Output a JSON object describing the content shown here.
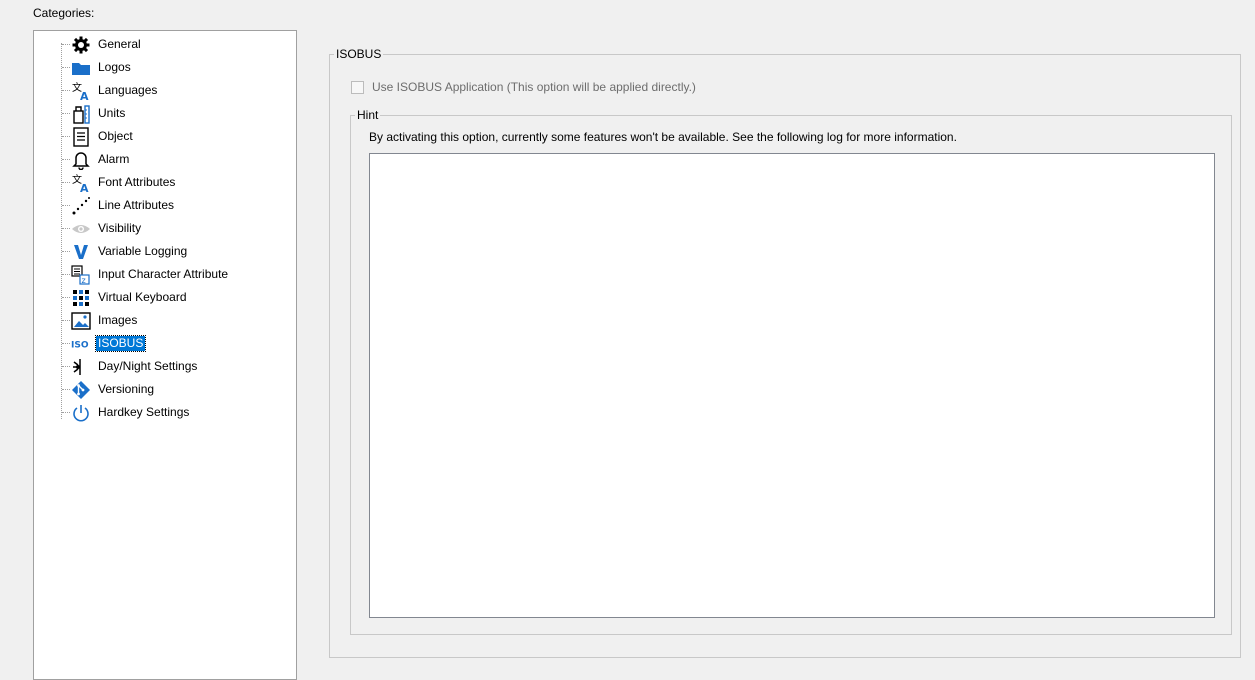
{
  "categories_label": "Categories:",
  "tree": {
    "items": [
      {
        "label": "General",
        "icon": "gear-icon"
      },
      {
        "label": "Logos",
        "icon": "folder-icon"
      },
      {
        "label": "Languages",
        "icon": "translate-icon"
      },
      {
        "label": "Units",
        "icon": "units-icon"
      },
      {
        "label": "Object",
        "icon": "document-icon"
      },
      {
        "label": "Alarm",
        "icon": "bell-icon"
      },
      {
        "label": "Font Attributes",
        "icon": "translate-icon"
      },
      {
        "label": "Line Attributes",
        "icon": "dotted-line-icon"
      },
      {
        "label": "Visibility",
        "icon": "eye-icon"
      },
      {
        "label": "Variable Logging",
        "icon": "v-icon"
      },
      {
        "label": "Input Character Attribute",
        "icon": "input-char-icon"
      },
      {
        "label": "Virtual Keyboard",
        "icon": "keyboard-grid-icon"
      },
      {
        "label": "Images",
        "icon": "image-icon"
      },
      {
        "label": "ISOBUS",
        "icon": "iso-icon"
      },
      {
        "label": "Day/Night Settings",
        "icon": "day-night-icon"
      },
      {
        "label": "Versioning",
        "icon": "git-icon"
      },
      {
        "label": "Hardkey Settings",
        "icon": "power-icon"
      }
    ],
    "selected": "ISOBUS"
  },
  "isobus": {
    "group_title": "ISOBUS",
    "checkbox_label": "Use ISOBUS Application (This option will be applied directly.)",
    "checkbox_checked": false,
    "checkbox_enabled": false
  },
  "hint": {
    "group_title": "Hint",
    "text": "By activating this option, currently some features won't be available. See the following  log for more information.",
    "log": ""
  },
  "colors": {
    "selection": "#0078d7",
    "icon_blue": "#1a6fc9",
    "background": "#f0f0f0"
  }
}
